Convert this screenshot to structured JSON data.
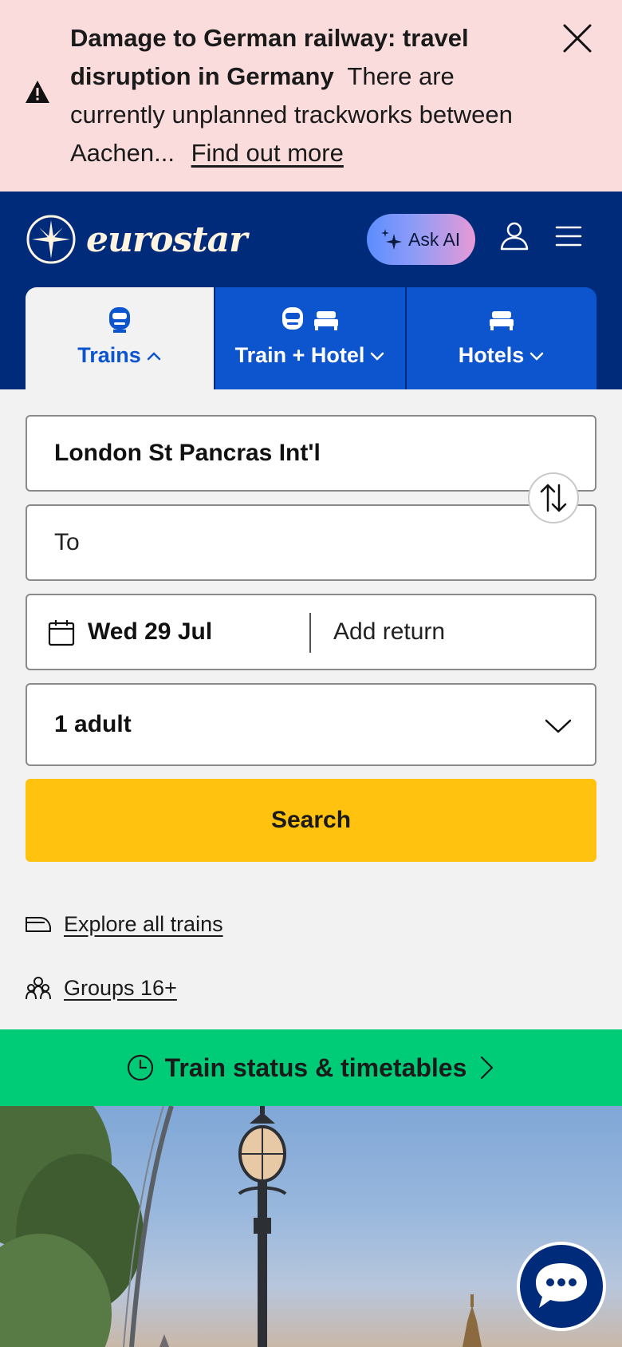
{
  "alert": {
    "title": "Damage to German railway: travel disruption in Germany",
    "message": "There are currently unplanned trackworks between Aachen...",
    "link": "Find out more"
  },
  "header": {
    "brand": "eurostar",
    "ask_ai": "Ask AI"
  },
  "tabs": [
    {
      "label": "Trains",
      "active": true,
      "icons": [
        "train-icon"
      ]
    },
    {
      "label": "Train + Hotel",
      "active": false,
      "icons": [
        "train-icon",
        "bed-icon"
      ]
    },
    {
      "label": "Hotels",
      "active": false,
      "icons": [
        "bed-icon"
      ]
    }
  ],
  "form": {
    "origin": "London St Pancras Int'l",
    "destination_placeholder": "To",
    "depart_date": "Wed 29 Jul",
    "return_label": "Add return",
    "passengers": "1 adult",
    "search_label": "Search"
  },
  "links": {
    "explore": "Explore all trains",
    "groups": "Groups 16+"
  },
  "status_bar": {
    "label": "Train status & timetables"
  },
  "colors": {
    "alert_bg": "#fbdcdc",
    "brand_navy": "#002a7a",
    "tab_blue": "#0d55cf",
    "search_yellow": "#ffc20e",
    "status_green": "#00cc77"
  }
}
